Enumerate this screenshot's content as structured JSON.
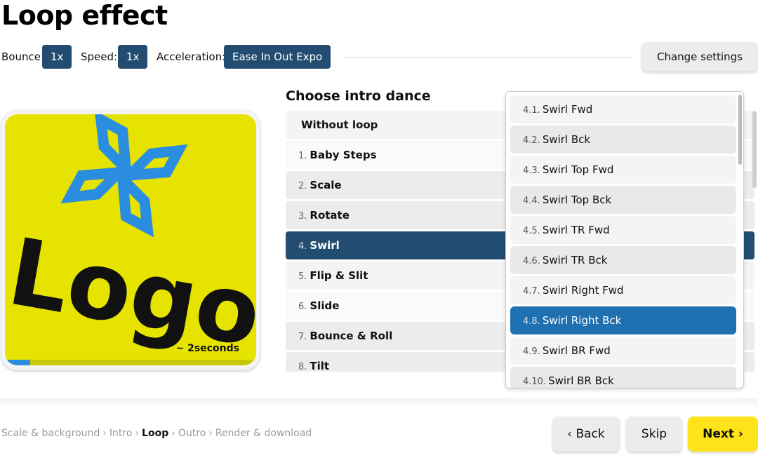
{
  "page": {
    "title": "Loop effect"
  },
  "settings": {
    "bounce_label": "Bounce:",
    "bounce_value": "1x",
    "speed_label": "Speed:",
    "speed_value": "1x",
    "acceleration_label": "Acceleration:",
    "acceleration_value": "Ease In Out Expo",
    "change_button": "Change settings"
  },
  "preview": {
    "logo_text": "Logo",
    "duration": "~  2seconds",
    "progress": 0.1,
    "colors": {
      "background": "#e6e300",
      "logo_mark": "#2a8de0",
      "logo_text": "#111111"
    }
  },
  "dance_list": {
    "heading": "Choose intro dance",
    "items": [
      {
        "num": "",
        "label": "Without loop"
      },
      {
        "num": "1.",
        "label": "Baby Steps"
      },
      {
        "num": "2.",
        "label": "Scale"
      },
      {
        "num": "3.",
        "label": "Rotate"
      },
      {
        "num": "4.",
        "label": "Swirl",
        "selected": true
      },
      {
        "num": "5.",
        "label": "Flip & Slit"
      },
      {
        "num": "6.",
        "label": "Slide"
      },
      {
        "num": "7.",
        "label": "Bounce & Roll"
      },
      {
        "num": "8.",
        "label": "Tilt"
      }
    ]
  },
  "submenu": {
    "items": [
      {
        "num": "4.1.",
        "label": "Swirl Fwd"
      },
      {
        "num": "4.2.",
        "label": "Swirl Bck"
      },
      {
        "num": "4.3.",
        "label": "Swirl Top Fwd"
      },
      {
        "num": "4.4.",
        "label": "Swirl Top Bck"
      },
      {
        "num": "4.5.",
        "label": "Swirl TR Fwd"
      },
      {
        "num": "4.6.",
        "label": "Swirl TR Bck"
      },
      {
        "num": "4.7.",
        "label": "Swirl Right Fwd"
      },
      {
        "num": "4.8.",
        "label": "Swirl Right Bck",
        "selected": true
      },
      {
        "num": "4.9.",
        "label": "Swirl BR Fwd"
      },
      {
        "num": "4.10.",
        "label": "Swirl BR Bck"
      }
    ]
  },
  "breadcrumb": {
    "steps": [
      "Scale & background",
      "Intro",
      "Loop",
      "Outro",
      "Render & download"
    ],
    "separator": "›",
    "current": "Loop"
  },
  "nav": {
    "back": "‹ Back",
    "skip": "Skip",
    "next": "Next ›"
  },
  "colors": {
    "chip": "#234d70",
    "selected_item": "#234d70",
    "selected_sub": "#1f70b0",
    "next_button": "#ffe31a"
  }
}
